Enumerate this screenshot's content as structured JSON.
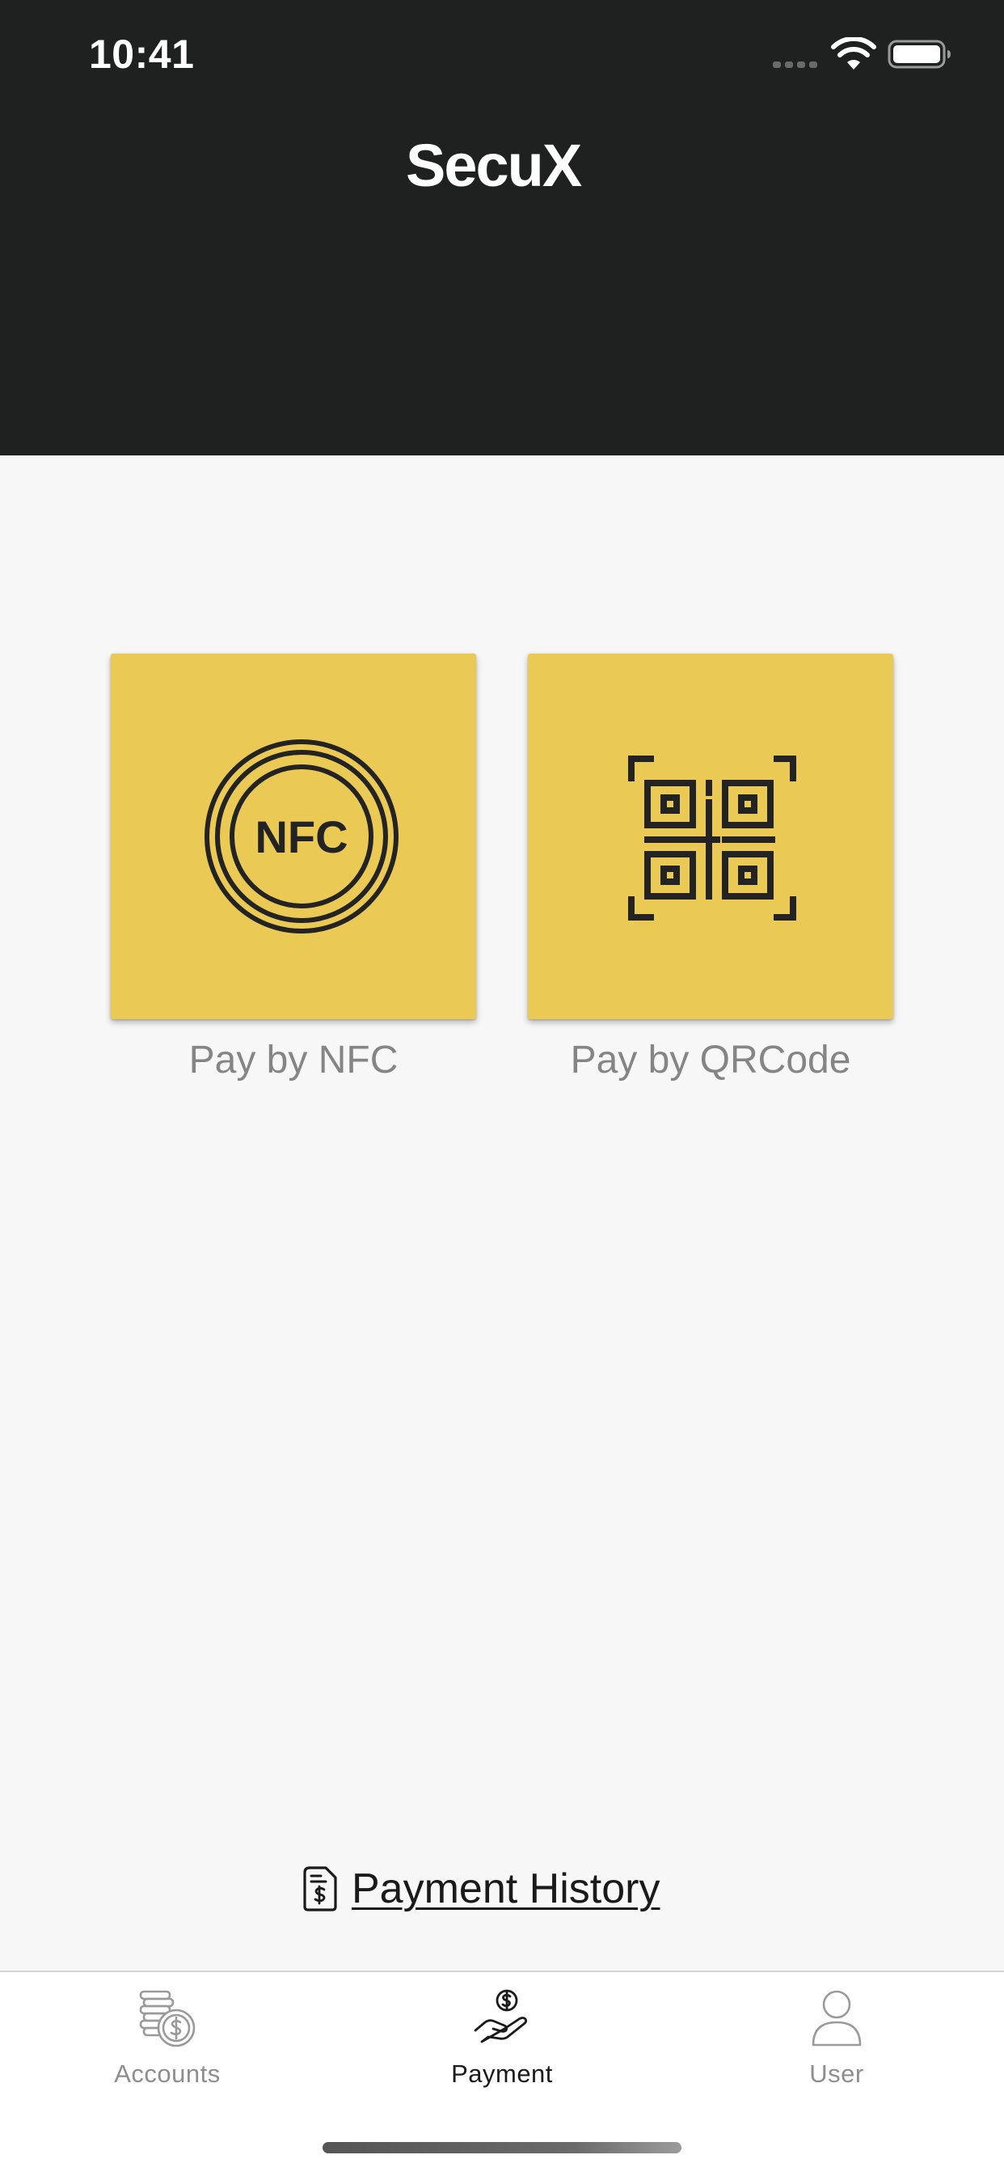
{
  "status_bar": {
    "time": "10:41"
  },
  "header": {
    "brand": "SecuX"
  },
  "payment_options": [
    {
      "label": "Pay by NFC",
      "icon": "nfc-icon",
      "icon_text": "NFC"
    },
    {
      "label": "Pay by QRCode",
      "icon": "qr-code-icon"
    }
  ],
  "history": {
    "label": "Payment History",
    "icon": "receipt-dollar-icon"
  },
  "tabbar": {
    "items": [
      {
        "label": "Accounts",
        "icon": "coins-icon",
        "active": false
      },
      {
        "label": "Payment",
        "icon": "hand-coin-icon",
        "active": true
      },
      {
        "label": "User",
        "icon": "user-icon",
        "active": false
      }
    ]
  },
  "colors": {
    "header_bg": "#1f2020",
    "tile_bg": "#ebc955",
    "page_bg": "#f7f7f7",
    "inactive_tab": "#8e8e8e",
    "active_tab": "#1a1a1a"
  }
}
